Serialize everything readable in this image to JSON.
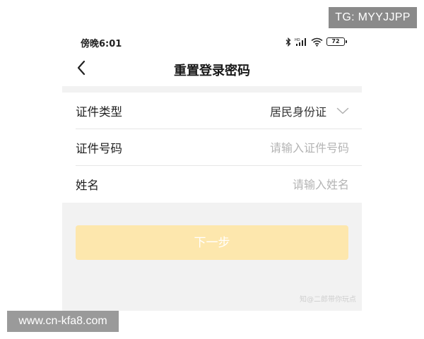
{
  "watermarks": {
    "top": "TG: MYYJJPP",
    "bottom": "www.cn-kfa8.com",
    "inner": "知@二郎带你玩点"
  },
  "status_bar": {
    "time": "傍晚6:01",
    "battery": "72",
    "icons": [
      "bluetooth-icon",
      "signal-icon",
      "wifi-icon",
      "battery-icon"
    ]
  },
  "nav": {
    "back_icon": "chevron-left-icon",
    "title": "重置登录密码"
  },
  "form": {
    "id_type": {
      "label": "证件类型",
      "value": "居民身份证",
      "icon": "chevron-down-icon"
    },
    "id_number": {
      "label": "证件号码",
      "placeholder": "请输入证件号码",
      "value": ""
    },
    "name": {
      "label": "姓名",
      "placeholder": "请输入姓名",
      "value": ""
    }
  },
  "actions": {
    "next_label": "下一步"
  },
  "colors": {
    "next_button_bg": "#fde7ad",
    "section_bg": "#f2f2f2",
    "placeholder": "#b4b4b4"
  }
}
